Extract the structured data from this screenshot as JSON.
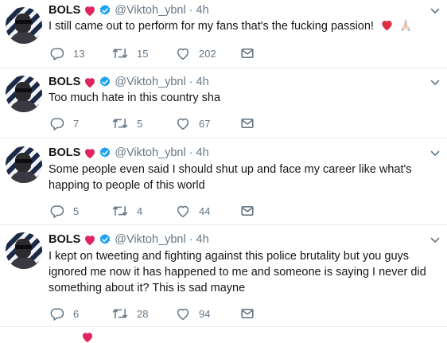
{
  "user": {
    "name": "BOLS",
    "handle": "@Viktoh_ybnl",
    "separator": "·"
  },
  "colors": {
    "heart": "#e0245e",
    "verified": "#1da1f2",
    "muted": "#657786",
    "text": "#14171a",
    "divider": "#e6ecf0"
  },
  "tweets": [
    {
      "time": "4h",
      "text": "I still came out to perform for my fans that's the fucking passion!",
      "emoji": [
        "red-heart",
        "folded-hands"
      ],
      "replies": "13",
      "retweets": "15",
      "likes": "202"
    },
    {
      "time": "4h",
      "text": "Too much hate in this country sha",
      "replies": "7",
      "retweets": "5",
      "likes": "67"
    },
    {
      "time": "4h",
      "text": "Some people even said I should shut up and face my career like what's happing to people of this world",
      "replies": "5",
      "retweets": "4",
      "likes": "44"
    },
    {
      "time": "4h",
      "text": "I kept on tweeting and fighting against this police brutality but you guys ignored me now it has happened to me and someone is saying I never did something about it? This is sad mayne",
      "replies": "6",
      "retweets": "28",
      "likes": "94"
    }
  ]
}
